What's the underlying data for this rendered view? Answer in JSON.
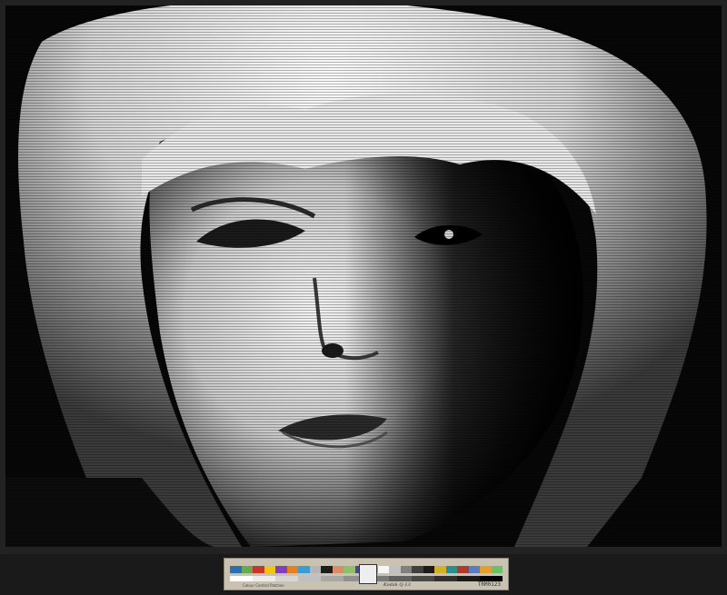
{
  "photo": {
    "subject": "black-and-white close-up portrait of a blonde woman on a TV screen with scanlines"
  },
  "color_target": {
    "brand_text": "Kodak Q-13",
    "id_label": "TRM0123",
    "scale_text": "Colour Control Patches",
    "colors": [
      "#2a6fb0",
      "#6aa84f",
      "#c0392b",
      "#f1c40f",
      "#7f3fbf",
      "#e67e22",
      "#3d9bd4",
      "#b5b5b5",
      "#1d1d1d",
      "#d98b6a",
      "#8fbf6a",
      "#4a4a8a",
      "#c97fb0",
      "#f5f5f5",
      "#c0c0c0",
      "#808080",
      "#404040",
      "#1c1c1c",
      "#d4b02a",
      "#2c8f8f",
      "#b03a2e",
      "#5b7dbf",
      "#e0a030",
      "#6ac06a"
    ],
    "grays": [
      "#ffffff",
      "#ececec",
      "#d6d6d6",
      "#c0c0c0",
      "#a8a8a8",
      "#909090",
      "#787878",
      "#606060",
      "#484848",
      "#303030",
      "#1a1a1a",
      "#000000"
    ]
  }
}
